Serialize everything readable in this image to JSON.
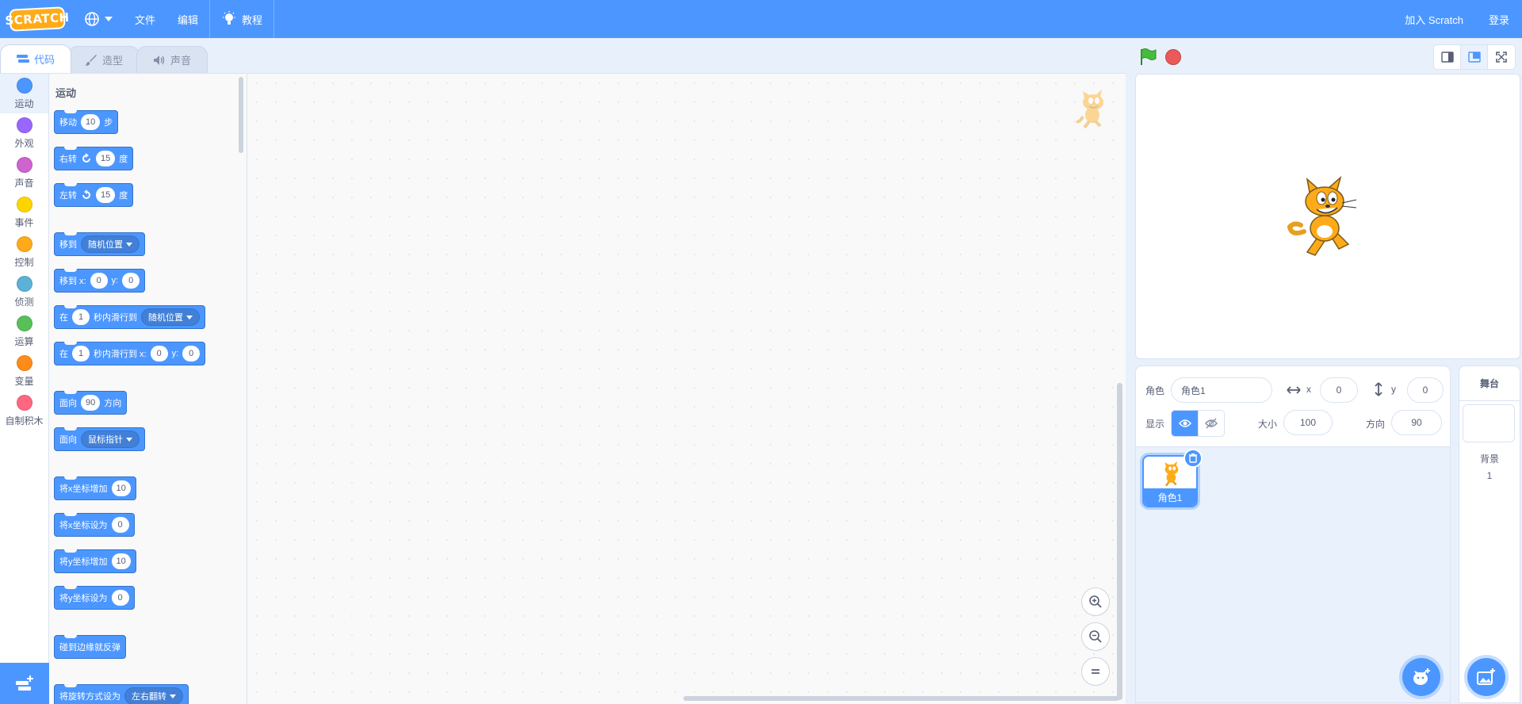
{
  "topbar": {
    "logo": "SCRATCH",
    "menu_file": "文件",
    "menu_edit": "编辑",
    "tutorials": "教程",
    "join": "加入 Scratch",
    "signin": "登录"
  },
  "tabs": [
    {
      "label": "代码"
    },
    {
      "label": "造型"
    },
    {
      "label": "声音"
    }
  ],
  "categories": [
    {
      "label": "运动",
      "color": "#4c97ff"
    },
    {
      "label": "外观",
      "color": "#9966ff"
    },
    {
      "label": "声音",
      "color": "#cf63cf"
    },
    {
      "label": "事件",
      "color": "#ffd500"
    },
    {
      "label": "控制",
      "color": "#ffab19"
    },
    {
      "label": "侦测",
      "color": "#5cb1d6"
    },
    {
      "label": "运算",
      "color": "#59c059"
    },
    {
      "label": "变量",
      "color": "#ff8c1a"
    },
    {
      "label": "自制积木",
      "color": "#ff6680"
    }
  ],
  "palette": {
    "title": "运动",
    "move": {
      "a": "移动",
      "v": "10",
      "b": "步"
    },
    "turn_right": {
      "a": "右转",
      "v": "15",
      "b": "度"
    },
    "turn_left": {
      "a": "左转",
      "v": "15",
      "b": "度"
    },
    "goto": {
      "a": "移到",
      "dd": "随机位置"
    },
    "goto_xy": {
      "a": "移到 x:",
      "x": "0",
      "yl": "y:",
      "y": "0"
    },
    "glide": {
      "a": "在",
      "v": "1",
      "b": "秒内滑行到",
      "dd": "随机位置"
    },
    "glide_xy": {
      "a": "在",
      "v": "1",
      "b": "秒内滑行到 x:",
      "x": "0",
      "yl": "y:",
      "y": "0"
    },
    "point_dir": {
      "a": "面向",
      "v": "90",
      "b": "方向"
    },
    "point_towards": {
      "a": "面向",
      "dd": "鼠标指针"
    },
    "change_x": {
      "a": "将x坐标增加",
      "v": "10"
    },
    "set_x": {
      "a": "将x坐标设为",
      "v": "0"
    },
    "change_y": {
      "a": "将y坐标增加",
      "v": "10"
    },
    "set_y": {
      "a": "将y坐标设为",
      "v": "0"
    },
    "bounce": {
      "a": "碰到边缘就反弹"
    },
    "rotation": {
      "a": "将旋转方式设为",
      "dd": "左右翻转"
    }
  },
  "sprite_info": {
    "sprite_label": "角色",
    "sprite_name": "角色1",
    "x_label": "x",
    "x": "0",
    "y_label": "y",
    "y": "0",
    "show_label": "显示",
    "size_label": "大小",
    "size": "100",
    "direction_label": "方向",
    "direction": "90"
  },
  "sprites": [
    {
      "name": "角色1"
    }
  ],
  "stage_pane": {
    "title": "舞台",
    "backdrop_label": "背景",
    "backdrop_count": "1"
  },
  "colors": {
    "accent": "#4c97ff",
    "stop": "#ec5959",
    "flag": "#45bd3b"
  }
}
